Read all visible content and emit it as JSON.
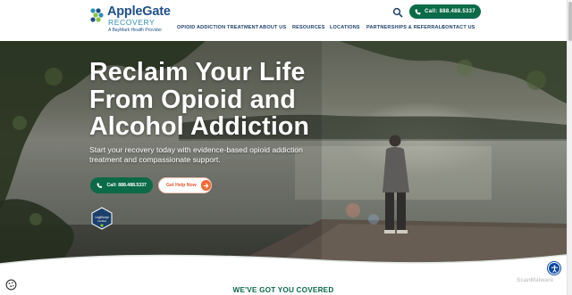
{
  "header": {
    "logo": {
      "name": "AppleGate",
      "sub": "RECOVERY",
      "tagline": "A BayMark Health Provider"
    },
    "call_button": "Call: 888.488.5337",
    "nav": [
      "OPIOID ADDICTION TREATMENT",
      "ABOUT US",
      "RESOURCES",
      "LOCATIONS",
      "PARTNERSHIPS & REFERRALS",
      "CONTACT US"
    ],
    "icons": {
      "search": "search-icon",
      "phone": "phone-icon"
    }
  },
  "hero": {
    "title": "Reclaim Your Life From Opioid and Alcohol Addiction",
    "subtitle": "Start your recovery today with evidence-based opioid addiction treatment and compassionate support.",
    "call_button": "Call: 888.488.5337",
    "help_button": "Get Help Now",
    "badge": {
      "line1": "LegitScript",
      "line2": "Certified"
    }
  },
  "section": {
    "heading": "WE'VE GOT YOU COVERED"
  },
  "widgets": {
    "scan_badge": "ScanMalware",
    "accessibility": "accessibility-icon",
    "cookie": "cookie-icon"
  },
  "colors": {
    "brand_green": "#0b6a47",
    "brand_blue": "#1d5189",
    "accent_orange": "#f06a36"
  }
}
